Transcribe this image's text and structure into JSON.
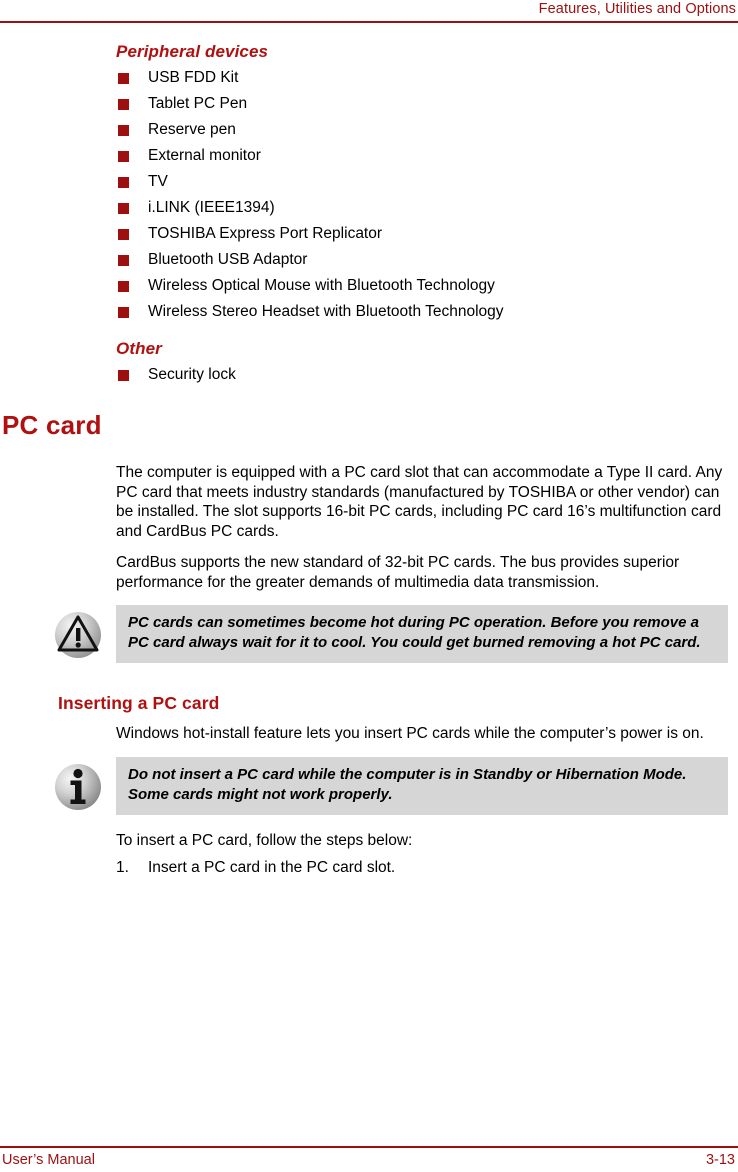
{
  "header": {
    "title": "Features, Utilities and Options",
    "rule_color": "#9e1010"
  },
  "peripheral_section": {
    "heading": "Peripheral devices",
    "items": [
      {
        "label": "USB FDD Kit"
      },
      {
        "label": "Tablet PC Pen"
      },
      {
        "label": "Reserve pen"
      },
      {
        "label": "External monitor"
      },
      {
        "label": "TV"
      },
      {
        "label": "i.LINK (IEEE1394)"
      },
      {
        "label": "TOSHIBA Express Port Replicator"
      },
      {
        "label": "Bluetooth USB Adaptor"
      },
      {
        "label": "Wireless Optical Mouse with Bluetooth Technology"
      },
      {
        "label": "Wireless Stereo Headset with Bluetooth Technology"
      }
    ]
  },
  "other_section": {
    "heading": "Other",
    "items": [
      {
        "label": "Security lock"
      }
    ]
  },
  "pc_card": {
    "heading": "PC card",
    "paragraph_1": "The computer is equipped with a PC card slot that can accommodate a Type II card. Any PC card that meets industry standards (manufactured by TOSHIBA or other vendor) can be installed. The slot supports 16-bit PC cards, including PC card 16’s multifunction card and CardBus PC cards.",
    "paragraph_2": "CardBus supports the new standard of 32-bit PC cards. The bus provides superior performance for the greater demands of multimedia data transmission.",
    "caution": {
      "icon": "caution-triangle-icon",
      "text": "PC cards can sometimes become hot during PC operation. Before you remove a PC card always wait for it to cool. You could get burned removing a hot PC card."
    }
  },
  "inserting_section": {
    "heading": "Inserting a PC card",
    "paragraph_1": "Windows hot-install feature lets you insert PC cards while the computer’s power is on.",
    "note": {
      "icon": "info-i-icon",
      "text": "Do not insert a PC card while the computer is in Standby or Hibernation Mode. Some cards might not work properly."
    },
    "paragraph_2": "To insert a PC card, follow the steps below:",
    "steps": [
      {
        "num": "1.",
        "label": "Insert a PC card in the PC card slot."
      }
    ]
  },
  "footer": {
    "left": "User’s Manual",
    "right": "3-13"
  },
  "colors": {
    "brand_red": "#9e1010",
    "heading_red": "#b01010",
    "note_gray": "#d6d6d6"
  }
}
